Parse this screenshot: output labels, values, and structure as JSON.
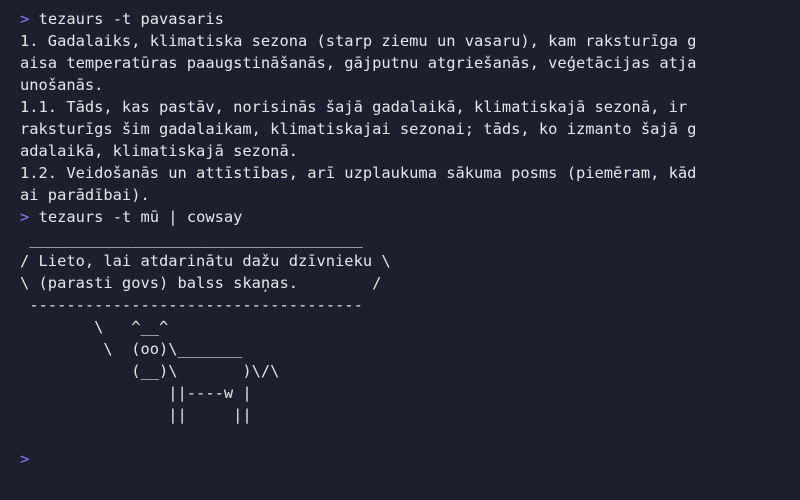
{
  "prompt_symbol": ">",
  "colors": {
    "background": "#1e1e2e",
    "text": "#e6e6ea",
    "prompt": "#8a7dff"
  },
  "session": [
    {
      "command": "tezaurs -t pavasaris",
      "output": [
        "1. Gadalaiks, klimatiska sezona (starp ziemu un vasaru), kam raksturīga g",
        "aisa temperatūras paaugstināšanās, gājputnu atgriešanās, veģetācijas atja",
        "unošanās.",
        "1.1. Tāds, kas pastāv, norisinās šajā gadalaikā, klimatiskajā sezonā, ir",
        "raksturīgs šim gadalaikam, klimatiskajai sezonai; tāds, ko izmanto šajā g",
        "adalaikā, klimatiskajā sezonā.",
        "1.2. Veidošanās un attīstības, arī uzplaukuma sākuma posms (piemēram, kād",
        "ai parādībai)."
      ]
    },
    {
      "command": "tezaurs -t mū | cowsay",
      "output": [
        " ____________________________________",
        "/ Lieto, lai atdarinātu dažu dzīvnieku \\",
        "\\ (parasti govs) balss skaņas.        /",
        " ------------------------------------",
        "        \\   ^__^",
        "         \\  (oo)\\_______",
        "            (__)\\       )\\/\\",
        "                ||----w |",
        "                ||     ||"
      ]
    }
  ]
}
